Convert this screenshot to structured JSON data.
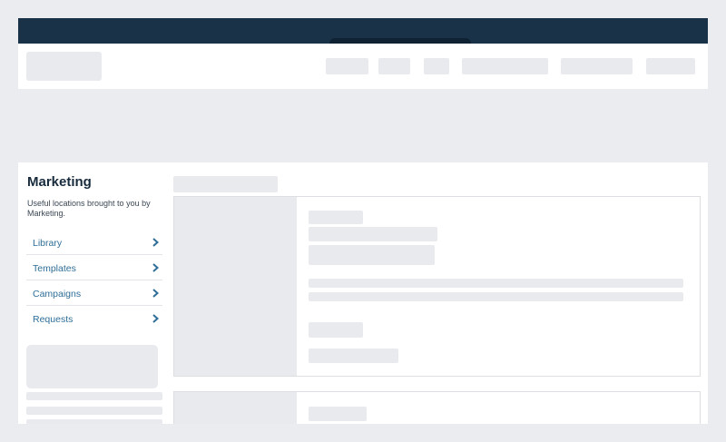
{
  "sidebar": {
    "title": "Marketing",
    "description": "Useful locations brought to you by Marketing.",
    "items": [
      {
        "label": "Library",
        "icon": "chevron-right-icon"
      },
      {
        "label": "Templates",
        "icon": "chevron-right-icon"
      },
      {
        "label": "Campaigns",
        "icon": "chevron-right-icon"
      },
      {
        "label": "Requests",
        "icon": "chevron-right-icon"
      }
    ]
  },
  "colors": {
    "topbar": "#193247",
    "link": "#2f6e97",
    "heading": "#172b3d",
    "placeholder": "#e9eaee",
    "background": "#ebecf0"
  }
}
